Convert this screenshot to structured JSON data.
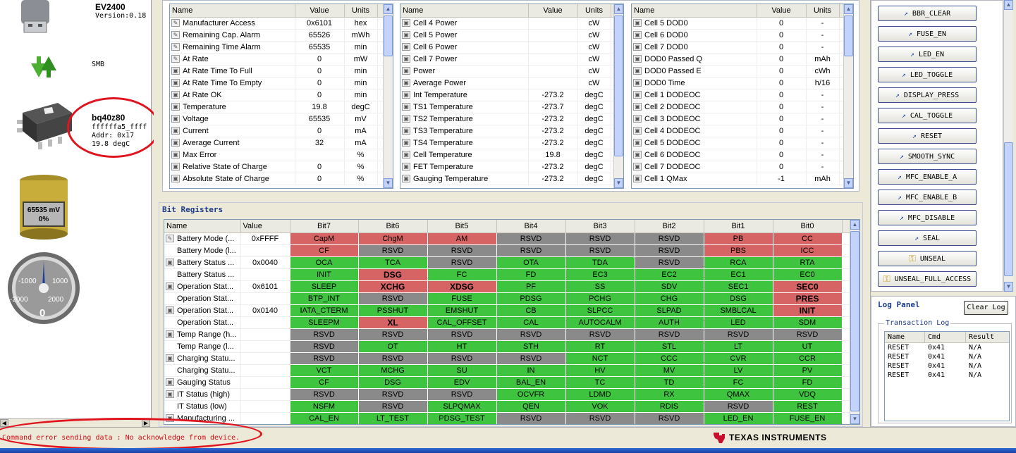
{
  "device": {
    "board": "EV2400",
    "version": "Version:0.18",
    "bus": "SMB",
    "chip": "bq40z80",
    "chip_id": "ffffffa5_ffff",
    "addr": "Addr: 0x17",
    "temp": "19.8 degC",
    "battery_voltage": "65535 mV",
    "battery_percent": "0%",
    "gauge_ticks": [
      "-1000",
      "1000",
      "-2000",
      "2000"
    ],
    "gauge_value": "0"
  },
  "headers": {
    "name": "Name",
    "value": "Value",
    "units": "Units"
  },
  "table1": [
    {
      "icon": "pencil",
      "name": "Manufacturer Access",
      "value": "0x6101",
      "units": "hex"
    },
    {
      "icon": "pencil",
      "name": "Remaining Cap. Alarm",
      "value": "65526",
      "units": "mWh"
    },
    {
      "icon": "pencil",
      "name": "Remaining Time Alarm",
      "value": "65535",
      "units": "min"
    },
    {
      "icon": "pencil",
      "name": "At Rate",
      "value": "0",
      "units": "mW"
    },
    {
      "icon": "lock",
      "name": "At Rate Time To Full",
      "value": "0",
      "units": "min"
    },
    {
      "icon": "lock",
      "name": "At Rate Time To Empty",
      "value": "0",
      "units": "min"
    },
    {
      "icon": "lock",
      "name": "At Rate OK",
      "value": "0",
      "units": "min"
    },
    {
      "icon": "lock",
      "name": "Temperature",
      "value": "19.8",
      "units": "degC"
    },
    {
      "icon": "lock",
      "name": "Voltage",
      "value": "65535",
      "units": "mV"
    },
    {
      "icon": "lock",
      "name": "Current",
      "value": "0",
      "units": "mA"
    },
    {
      "icon": "lock",
      "name": "Average Current",
      "value": "32",
      "units": "mA"
    },
    {
      "icon": "lock",
      "name": "Max Error",
      "value": "",
      "units": "%"
    },
    {
      "icon": "lock",
      "name": "Relative State of Charge",
      "value": "0",
      "units": "%"
    },
    {
      "icon": "lock",
      "name": "Absolute State of Charge",
      "value": "0",
      "units": "%"
    }
  ],
  "table2": [
    {
      "icon": "lock",
      "name": "Cell 4 Power",
      "value": "",
      "units": "cW"
    },
    {
      "icon": "lock",
      "name": "Cell 5 Power",
      "value": "",
      "units": "cW"
    },
    {
      "icon": "lock",
      "name": "Cell 6 Power",
      "value": "",
      "units": "cW"
    },
    {
      "icon": "lock",
      "name": "Cell 7 Power",
      "value": "",
      "units": "cW"
    },
    {
      "icon": "lock",
      "name": "Power",
      "value": "",
      "units": "cW"
    },
    {
      "icon": "lock",
      "name": "Average Power",
      "value": "",
      "units": "cW"
    },
    {
      "icon": "lock",
      "name": "Int Temperature",
      "value": "-273.2",
      "units": "degC"
    },
    {
      "icon": "lock",
      "name": "TS1 Temperature",
      "value": "-273.7",
      "units": "degC"
    },
    {
      "icon": "lock",
      "name": "TS2 Temperature",
      "value": "-273.2",
      "units": "degC"
    },
    {
      "icon": "lock",
      "name": "TS3 Temperature",
      "value": "-273.2",
      "units": "degC"
    },
    {
      "icon": "lock",
      "name": "TS4 Temperature",
      "value": "-273.2",
      "units": "degC"
    },
    {
      "icon": "lock",
      "name": "Cell Temperature",
      "value": "19.8",
      "units": "degC"
    },
    {
      "icon": "lock",
      "name": "FET Temperature",
      "value": "-273.2",
      "units": "degC"
    },
    {
      "icon": "lock",
      "name": "Gauging Temperature",
      "value": "-273.2",
      "units": "degC"
    }
  ],
  "table3": [
    {
      "icon": "lock",
      "name": "Cell 5 DOD0",
      "value": "0",
      "units": "-"
    },
    {
      "icon": "lock",
      "name": "Cell 6 DOD0",
      "value": "0",
      "units": "-"
    },
    {
      "icon": "lock",
      "name": "Cell 7 DOD0",
      "value": "0",
      "units": "-"
    },
    {
      "icon": "lock",
      "name": "DOD0 Passed Q",
      "value": "0",
      "units": "mAh"
    },
    {
      "icon": "lock",
      "name": "DOD0 Passed E",
      "value": "0",
      "units": "cWh"
    },
    {
      "icon": "lock",
      "name": "DOD0 Time",
      "value": "0",
      "units": "h/16"
    },
    {
      "icon": "lock",
      "name": "Cell 1 DODEOC",
      "value": "0",
      "units": "-"
    },
    {
      "icon": "lock",
      "name": "Cell 2 DODEOC",
      "value": "0",
      "units": "-"
    },
    {
      "icon": "lock",
      "name": "Cell 3 DODEOC",
      "value": "0",
      "units": "-"
    },
    {
      "icon": "lock",
      "name": "Cell 4 DODEOC",
      "value": "0",
      "units": "-"
    },
    {
      "icon": "lock",
      "name": "Cell 5 DODEOC",
      "value": "0",
      "units": "-"
    },
    {
      "icon": "lock",
      "name": "Cell 6 DODEOC",
      "value": "0",
      "units": "-"
    },
    {
      "icon": "lock",
      "name": "Cell 7 DODEOC",
      "value": "0",
      "units": "-"
    },
    {
      "icon": "lock",
      "name": "Cell 1 QMax",
      "value": "-1",
      "units": "mAh"
    }
  ],
  "bit_registers": {
    "title": "Bit Registers",
    "headers": [
      "Name",
      "Value",
      "Bit7",
      "Bit6",
      "Bit5",
      "Bit4",
      "Bit3",
      "Bit2",
      "Bit1",
      "Bit0"
    ],
    "rows": [
      {
        "icon": "pencil",
        "name": "Battery Mode (...",
        "value": "0xFFFF",
        "bits": [
          "CapM",
          "ChgM",
          "AM",
          "RSVD",
          "RSVD",
          "RSVD",
          "PB",
          "CC"
        ],
        "colors": [
          "red",
          "red",
          "red",
          "gry",
          "gry",
          "gry",
          "red",
          "red"
        ]
      },
      {
        "icon": "",
        "name": "Battery Mode (l...",
        "value": "",
        "bits": [
          "CF",
          "RSVD",
          "RSVD",
          "RSVD",
          "RSVD",
          "RSVD",
          "PBS",
          "ICC"
        ],
        "colors": [
          "red",
          "gry",
          "gry",
          "gry",
          "gry",
          "gry",
          "red",
          "red"
        ]
      },
      {
        "icon": "lock",
        "name": "Battery Status ...",
        "value": "0x0040",
        "bits": [
          "OCA",
          "TCA",
          "RSVD",
          "OTA",
          "TDA",
          "RSVD",
          "RCA",
          "RTA"
        ],
        "colors": [
          "grn",
          "grn",
          "gry",
          "grn",
          "grn",
          "gry",
          "grn",
          "grn"
        ]
      },
      {
        "icon": "",
        "name": "Battery Status ...",
        "value": "",
        "bits": [
          "INIT",
          "DSG",
          "FC",
          "FD",
          "EC3",
          "EC2",
          "EC1",
          "EC0"
        ],
        "colors": [
          "grn",
          "red",
          "grn",
          "grn",
          "grn",
          "grn",
          "grn",
          "grn"
        ],
        "bold": [
          false,
          true,
          false,
          false,
          false,
          false,
          false,
          false
        ]
      },
      {
        "icon": "lock",
        "name": "Operation Stat...",
        "value": "0x6101",
        "bits": [
          "SLEEP",
          "XCHG",
          "XDSG",
          "PF",
          "SS",
          "SDV",
          "SEC1",
          "SEC0"
        ],
        "colors": [
          "grn",
          "red",
          "red",
          "grn",
          "grn",
          "grn",
          "grn",
          "red"
        ],
        "bold": [
          false,
          true,
          true,
          false,
          false,
          false,
          false,
          true
        ]
      },
      {
        "icon": "",
        "name": "Operation Stat...",
        "value": "",
        "bits": [
          "BTP_INT",
          "RSVD",
          "FUSE",
          "PDSG",
          "PCHG",
          "CHG",
          "DSG",
          "PRES"
        ],
        "colors": [
          "grn",
          "gry",
          "grn",
          "grn",
          "grn",
          "grn",
          "grn",
          "red"
        ],
        "bold": [
          false,
          false,
          false,
          false,
          false,
          false,
          false,
          true
        ]
      },
      {
        "icon": "lock",
        "name": "Operation Stat...",
        "value": "0x0140",
        "bits": [
          "IATA_CTERM",
          "PSSHUT",
          "EMSHUT",
          "CB",
          "SLPCC",
          "SLPAD",
          "SMBLCAL",
          "INIT"
        ],
        "colors": [
          "grn",
          "grn",
          "grn",
          "grn",
          "grn",
          "grn",
          "grn",
          "red"
        ],
        "bold": [
          false,
          false,
          false,
          false,
          false,
          false,
          false,
          true
        ]
      },
      {
        "icon": "",
        "name": "Operation Stat...",
        "value": "",
        "bits": [
          "SLEEPM",
          "XL",
          "CAL_OFFSET",
          "CAL",
          "AUTOCALM",
          "AUTH",
          "LED",
          "SDM"
        ],
        "colors": [
          "grn",
          "red",
          "grn",
          "grn",
          "grn",
          "grn",
          "grn",
          "grn"
        ],
        "bold": [
          false,
          true,
          false,
          false,
          false,
          false,
          false,
          false
        ]
      },
      {
        "icon": "lock",
        "name": "Temp Range (h...",
        "value": "",
        "bits": [
          "RSVD",
          "RSVD",
          "RSVD",
          "RSVD",
          "RSVD",
          "RSVD",
          "RSVD",
          "RSVD"
        ],
        "colors": [
          "gry",
          "gry",
          "gry",
          "gry",
          "gry",
          "gry",
          "gry",
          "gry"
        ]
      },
      {
        "icon": "",
        "name": "Temp Range (l...",
        "value": "",
        "bits": [
          "RSVD",
          "OT",
          "HT",
          "STH",
          "RT",
          "STL",
          "LT",
          "UT"
        ],
        "colors": [
          "gry",
          "grn",
          "grn",
          "grn",
          "grn",
          "grn",
          "grn",
          "grn"
        ]
      },
      {
        "icon": "lock",
        "name": "Charging Statu...",
        "value": "",
        "bits": [
          "RSVD",
          "RSVD",
          "RSVD",
          "RSVD",
          "NCT",
          "CCC",
          "CVR",
          "CCR"
        ],
        "colors": [
          "gry",
          "gry",
          "gry",
          "gry",
          "grn",
          "grn",
          "grn",
          "grn"
        ]
      },
      {
        "icon": "",
        "name": "Charging Statu...",
        "value": "",
        "bits": [
          "VCT",
          "MCHG",
          "SU",
          "IN",
          "HV",
          "MV",
          "LV",
          "PV"
        ],
        "colors": [
          "grn",
          "grn",
          "grn",
          "grn",
          "grn",
          "grn",
          "grn",
          "grn"
        ]
      },
      {
        "icon": "lock",
        "name": "Gauging Status",
        "value": "",
        "bits": [
          "CF",
          "DSG",
          "EDV",
          "BAL_EN",
          "TC",
          "TD",
          "FC",
          "FD"
        ],
        "colors": [
          "grn",
          "grn",
          "grn",
          "grn",
          "grn",
          "grn",
          "grn",
          "grn"
        ]
      },
      {
        "icon": "lock",
        "name": "IT Status (high)",
        "value": "",
        "bits": [
          "RSVD",
          "RSVD",
          "RSVD",
          "OCVFR",
          "LDMD",
          "RX",
          "QMAX",
          "VDQ"
        ],
        "colors": [
          "gry",
          "gry",
          "gry",
          "grn",
          "grn",
          "grn",
          "grn",
          "grn"
        ]
      },
      {
        "icon": "",
        "name": "IT Status (low)",
        "value": "",
        "bits": [
          "NSFM",
          "RSVD",
          "SLPQMAX",
          "QEN",
          "VOK",
          "RDIS",
          "RSVD",
          "REST"
        ],
        "colors": [
          "grn",
          "gry",
          "grn",
          "grn",
          "grn",
          "grn",
          "gry",
          "grn"
        ]
      },
      {
        "icon": "lock",
        "name": "Manufacturing ...",
        "value": "",
        "bits": [
          "CAL_EN",
          "LT_TEST",
          "PDSG_TEST",
          "RSVD",
          "RSVD",
          "RSVD",
          "LED_EN",
          "FUSE_EN"
        ],
        "colors": [
          "grn",
          "grn",
          "grn",
          "gry",
          "gry",
          "gry",
          "grn",
          "grn"
        ]
      }
    ]
  },
  "commands": [
    {
      "label": "BBR_CLEAR",
      "icon": "pin"
    },
    {
      "label": "FUSE_EN",
      "icon": "pin"
    },
    {
      "label": "LED_EN",
      "icon": "pin"
    },
    {
      "label": "LED_TOGGLE",
      "icon": "pin"
    },
    {
      "label": "DISPLAY_PRESS",
      "icon": "pin"
    },
    {
      "label": "CAL_TOGGLE",
      "icon": "pin"
    },
    {
      "label": "RESET",
      "icon": "pin"
    },
    {
      "label": "SMOOTH_SYNC",
      "icon": "pin"
    },
    {
      "label": "MFC_ENABLE_A",
      "icon": "pin"
    },
    {
      "label": "MFC_ENABLE_B",
      "icon": "pin"
    },
    {
      "label": "MFC_DISABLE",
      "icon": "pin"
    },
    {
      "label": "SEAL",
      "icon": "pin"
    },
    {
      "label": "UNSEAL",
      "icon": "key"
    },
    {
      "label": "UNSEAL_FULL_ACCESS",
      "icon": "key"
    }
  ],
  "log": {
    "title": "Log Panel",
    "clear_label": "Clear Log",
    "group_title": "Transaction Log",
    "headers": [
      "Name",
      "Cmd",
      "Result"
    ],
    "rows": [
      [
        "RESET",
        "0x41",
        "N/A"
      ],
      [
        "RESET",
        "0x41",
        "N/A"
      ],
      [
        "RESET",
        "0x41",
        "N/A"
      ],
      [
        "RESET",
        "0x41",
        "N/A"
      ]
    ]
  },
  "status": {
    "message": "Command error sending data : No acknowledge from device.",
    "brand": "TEXAS INSTRUMENTS"
  },
  "colors": {
    "red": "#d76464",
    "green": "#3ec43e",
    "gray": "#8a8a8a",
    "annotation": "#e0141e"
  }
}
